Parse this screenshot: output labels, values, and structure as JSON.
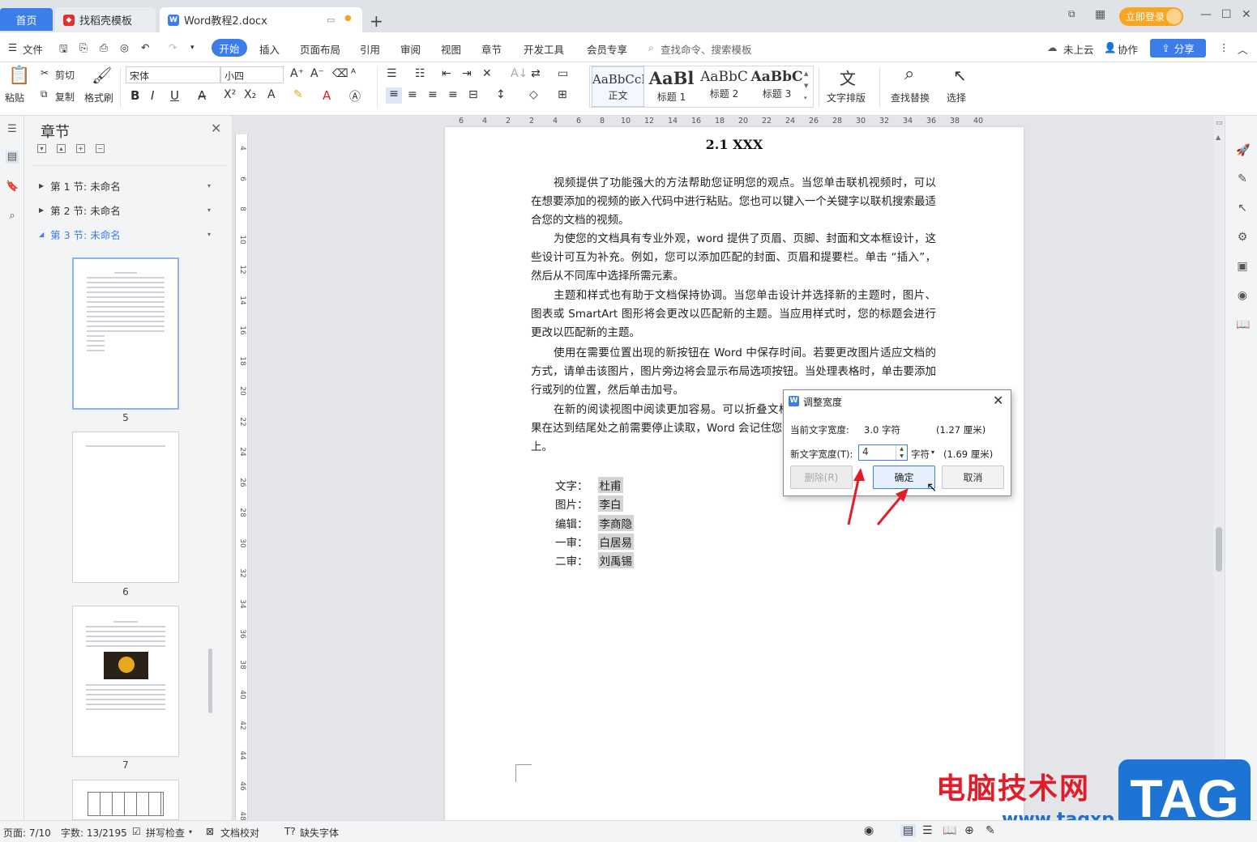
{
  "titlebar": {
    "tabs": [
      {
        "label": "首页"
      },
      {
        "label": "找稻壳模板"
      },
      {
        "label": "Word教程2.docx"
      }
    ],
    "login_label": "立即登录"
  },
  "menubar": {
    "file_label": "文件",
    "items": [
      "开始",
      "插入",
      "页面布局",
      "引用",
      "审阅",
      "视图",
      "章节",
      "开发工具",
      "会员专享"
    ],
    "search_placeholder": "查找命令、搜索模板",
    "cloud_label": "未上云",
    "collab_label": "协作",
    "share_label": "分享"
  },
  "ribbon": {
    "paste_label": "粘贴",
    "cut_label": "剪切",
    "copy_label": "复制",
    "format_painter_label": "格式刷",
    "font_name": "宋体",
    "font_size": "小四",
    "styles": [
      {
        "preview": "AaBbCcI",
        "label": "正文"
      },
      {
        "preview": "AaBl",
        "label": "标题 1"
      },
      {
        "preview": "AaBbC",
        "label": "标题 2"
      },
      {
        "preview": "AaBbC",
        "label": "标题 3"
      }
    ],
    "text_layout_label": "文字排版",
    "find_replace_label": "查找替换",
    "select_label": "选择"
  },
  "chapter_pane": {
    "title": "章节",
    "sections": [
      {
        "label": "第 1 节: 未命名"
      },
      {
        "label": "第 2 节: 未命名"
      },
      {
        "label": "第 3 节: 未命名"
      }
    ],
    "page_numbers": [
      "5",
      "6",
      "7"
    ]
  },
  "ruler": {
    "horizontal": [
      "6",
      "4",
      "2",
      "2",
      "4",
      "6",
      "8",
      "10",
      "12",
      "14",
      "16",
      "18",
      "20",
      "22",
      "24",
      "26",
      "28",
      "30",
      "32",
      "34",
      "36",
      "38",
      "40"
    ],
    "vertical": [
      "4",
      "6",
      "8",
      "10",
      "12",
      "14",
      "16",
      "18",
      "20",
      "22",
      "24",
      "26",
      "28",
      "30",
      "32",
      "34",
      "36",
      "38",
      "40",
      "42",
      "44",
      "46",
      "48"
    ]
  },
  "document": {
    "heading": "2.1 XXX",
    "paragraphs": [
      "视频提供了功能强大的方法帮助您证明您的观点。当您单击联机视频时，可以在想要添加的视频的嵌入代码中进行粘贴。您也可以键入一个关键字以联机搜索最适合您的文档的视频。",
      "为使您的文档具有专业外观，word 提供了页眉、页脚、封面和文本框设计，这些设计可互为补充。例如，您可以添加匹配的封面、页眉和提要栏。单击 “插入”，然后从不同库中选择所需元素。",
      "主题和样式也有助于文档保持协调。当您单击设计并选择新的主题时，图片、图表或 SmartArt 图形将会更改以匹配新的主题。当应用样式时，您的标题会进行更改以匹配新的主题。",
      "使用在需要位置出现的新按钮在 Word 中保存时间。若要更改图片适应文档的方式，请单击该图片，图片旁边将会显示布局选项按钮。当处理表格时，单击要添加行或列的位置，然后单击加号。",
      "在新的阅读视图中阅读更加容易。可以折叠文档某些部分并关注所需文本。如果在达到结尾处之前需要停止读取，Word 会记住您的停止位置 - 即使在另一个设备上。"
    ],
    "credits": [
      {
        "role": "文字：",
        "name": "杜甫"
      },
      {
        "role": "图片：",
        "name": "李白"
      },
      {
        "role": "编辑：",
        "name": "李商隐"
      },
      {
        "role": "一审：",
        "name": "白居易"
      },
      {
        "role": "二审：",
        "name": "刘禹锡"
      }
    ]
  },
  "dialog": {
    "title": "调整宽度",
    "current_label": "当前文字宽度:",
    "current_value": "3.0 字符",
    "current_cm": "(1.27 厘米)",
    "new_label": "新文字宽度(T):",
    "new_value": "4",
    "unit": "字符",
    "new_cm": "(1.69 厘米)",
    "delete_label": "删除(R)",
    "ok_label": "确定",
    "cancel_label": "取消"
  },
  "statusbar": {
    "page": "页面: 7/10",
    "words": "字数: 13/2195",
    "spellcheck": "拼写检查",
    "proofread": "文档校对",
    "missing_font": "缺失字体"
  },
  "watermark": {
    "text": "电脑技术网",
    "url": "www.tagxp.com",
    "tag": "TAG"
  },
  "colors": {
    "accent": "#3b7de9",
    "login": "#f5a623",
    "arrow": "#e11d2a"
  }
}
